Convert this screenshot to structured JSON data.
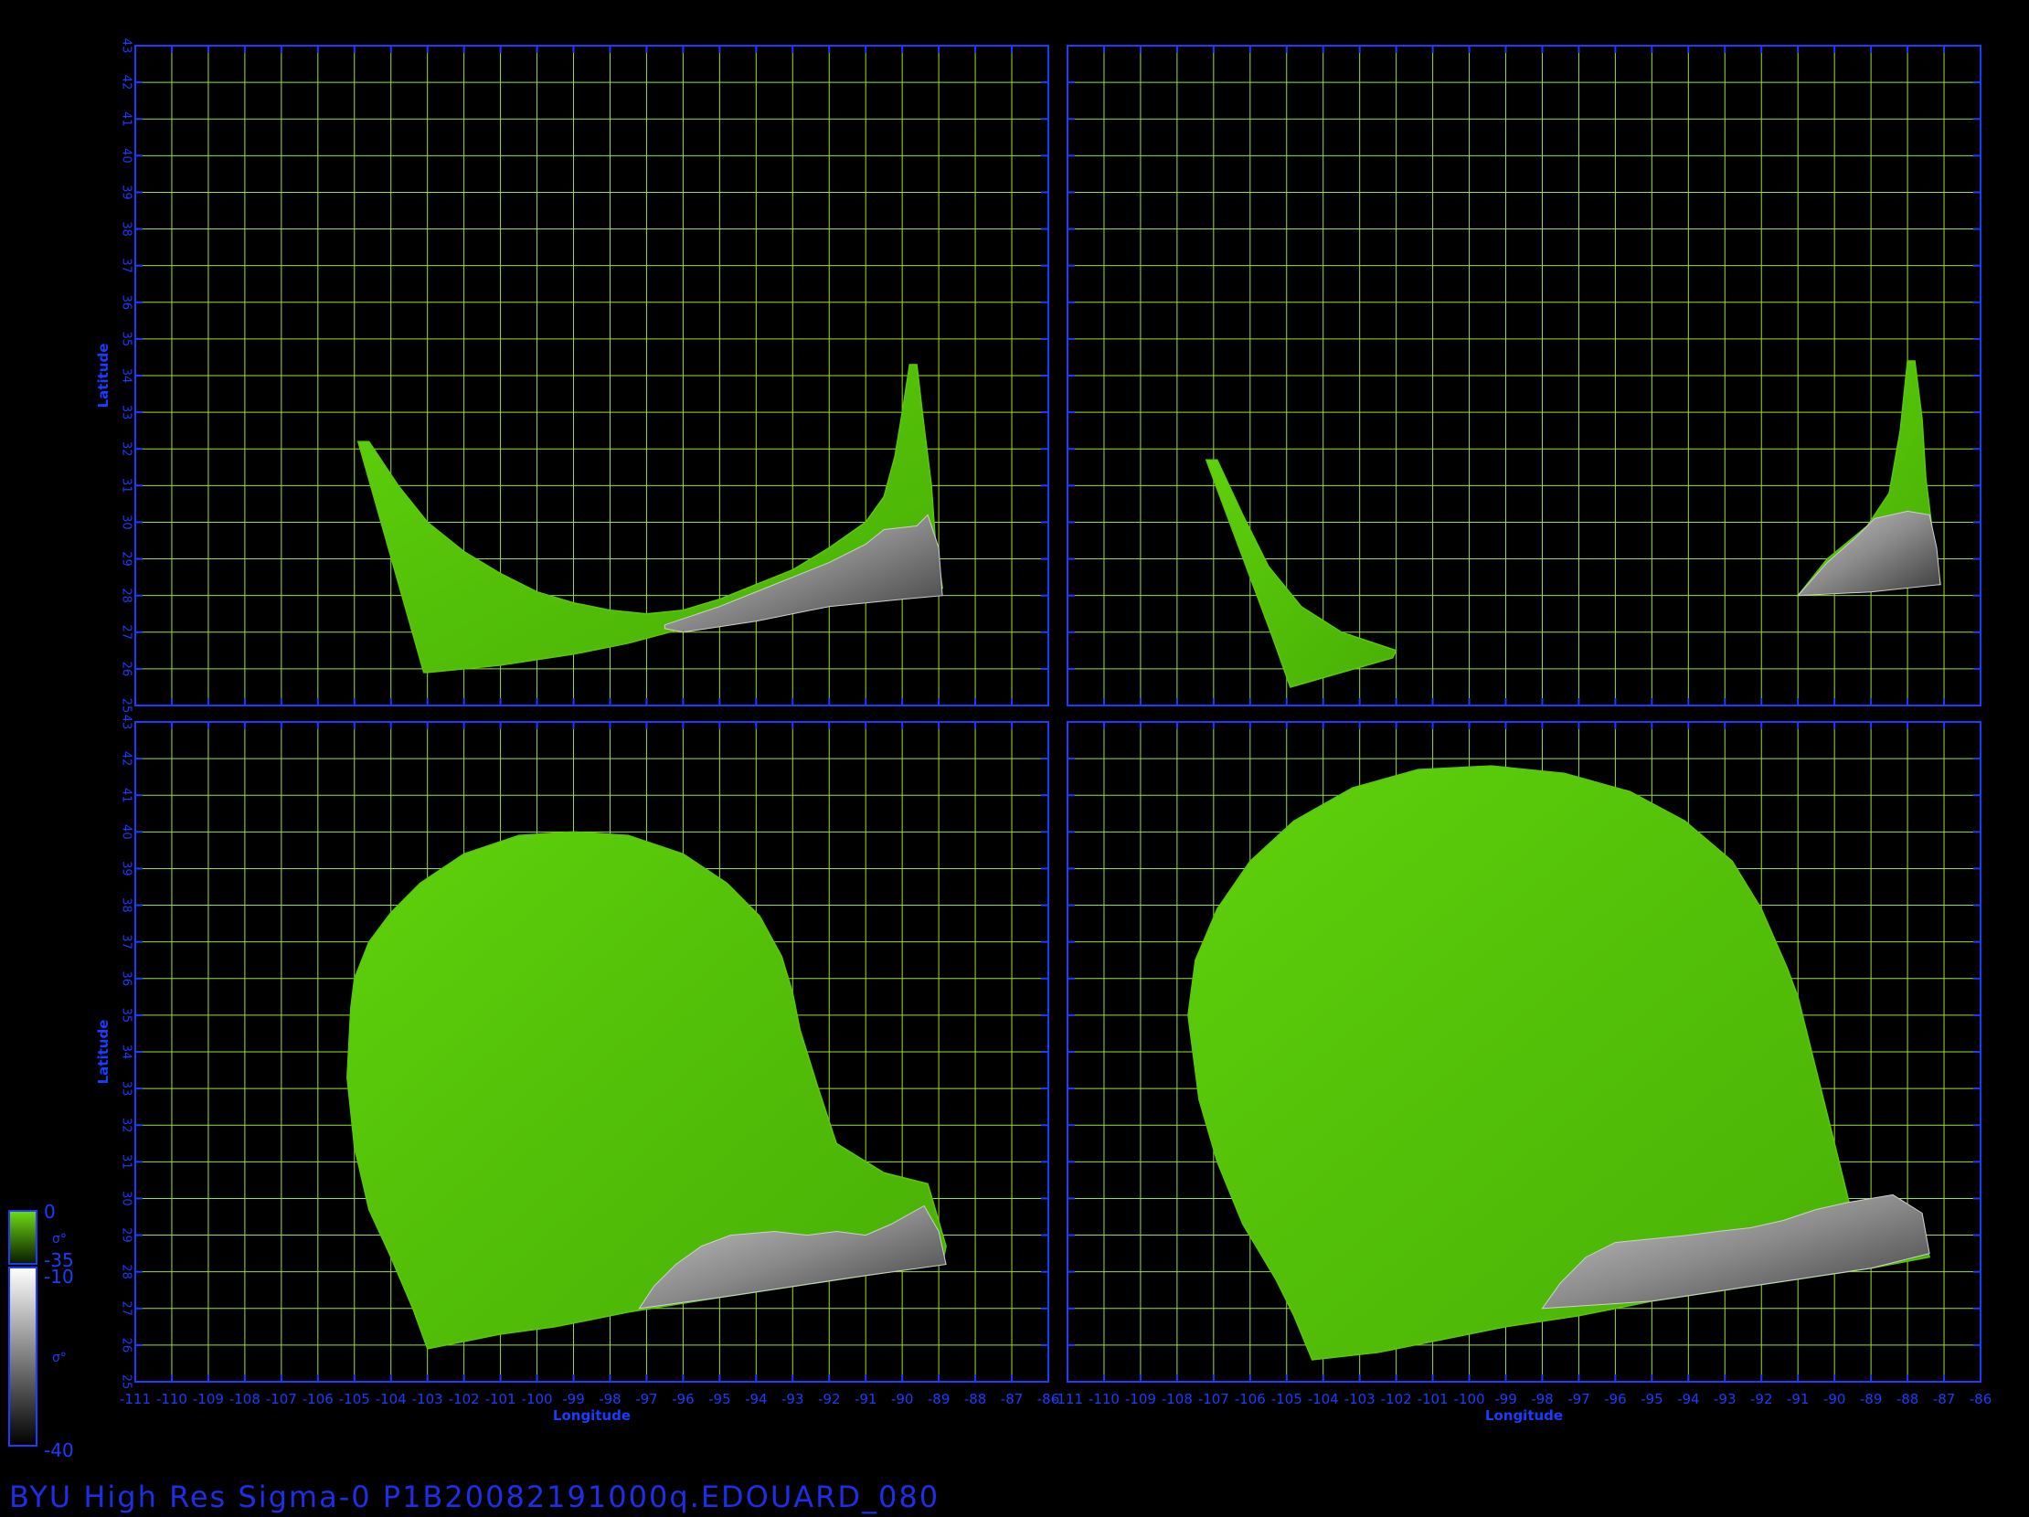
{
  "title": "BYU High Res Sigma-0 P1B20082191000q.EDOUARD_080",
  "axes": {
    "xlabel": "Longitude",
    "ylabel": "Latitude",
    "lon_range": [
      -111,
      -86
    ],
    "lat_range": [
      25,
      43
    ],
    "lon_ticks": [
      "-111",
      "-110",
      "-109",
      "-108",
      "-107",
      "-106",
      "-105",
      "-104",
      "-103",
      "-102",
      "-101",
      "-100",
      "-99",
      "-98",
      "-97",
      "-96",
      "-95",
      "-94",
      "-93",
      "-92",
      "-91",
      "-90",
      "-89",
      "-88",
      "-87",
      "-86"
    ],
    "lat_ticks": [
      "25",
      "26",
      "27",
      "28",
      "29",
      "30",
      "31",
      "32",
      "33",
      "34",
      "35",
      "36",
      "37",
      "38",
      "39",
      "40",
      "41",
      "42",
      "43"
    ]
  },
  "colorbar": {
    "ocean_top": "0",
    "ocean_bottom": "-35",
    "land_top": "-10",
    "land_bottom": "-40",
    "ocean_symbol": "σ°",
    "land_symbol": "σ°"
  },
  "colors": {
    "frame": "#1a3cff",
    "grid": "#9ce02a",
    "ocean": "#56c80a",
    "land": "#9a9a9a",
    "background": "#000000"
  },
  "panels": [
    {
      "id": "top-left",
      "ocean_swath": [
        [
          -104.9,
          32.2
        ],
        [
          -104.6,
          32.2
        ],
        [
          -103.8,
          31.0
        ],
        [
          -103.0,
          30.0
        ],
        [
          -102.0,
          29.2
        ],
        [
          -101.0,
          28.6
        ],
        [
          -100.0,
          28.1
        ],
        [
          -99.0,
          27.8
        ],
        [
          -98.0,
          27.6
        ],
        [
          -97.0,
          27.5
        ],
        [
          -96.0,
          27.6
        ],
        [
          -95.0,
          27.9
        ],
        [
          -94.0,
          28.3
        ],
        [
          -93.0,
          28.7
        ],
        [
          -92.0,
          29.3
        ],
        [
          -91.0,
          30.0
        ],
        [
          -90.5,
          30.7
        ],
        [
          -90.2,
          31.8
        ],
        [
          -90.0,
          33.0
        ],
        [
          -89.8,
          34.3
        ],
        [
          -89.6,
          34.3
        ],
        [
          -89.4,
          32.6
        ],
        [
          -89.2,
          31.0
        ],
        [
          -89.1,
          29.6
        ],
        [
          -88.9,
          28.2
        ],
        [
          -90.0,
          28.0
        ],
        [
          -92.0,
          27.8
        ],
        [
          -94.0,
          27.4
        ],
        [
          -96.0,
          27.1
        ],
        [
          -97.5,
          26.7
        ],
        [
          -99.0,
          26.4
        ],
        [
          -101.0,
          26.1
        ],
        [
          -103.0,
          25.9
        ],
        [
          -103.1,
          25.9
        ]
      ],
      "land_swath": [
        [
          -96.5,
          27.2
        ],
        [
          -95.0,
          27.7
        ],
        [
          -93.5,
          28.3
        ],
        [
          -92.0,
          28.9
        ],
        [
          -91.0,
          29.4
        ],
        [
          -90.5,
          29.8
        ],
        [
          -89.6,
          29.9
        ],
        [
          -89.3,
          30.2
        ],
        [
          -89.0,
          29.3
        ],
        [
          -88.9,
          28.0
        ],
        [
          -90.0,
          27.9
        ],
        [
          -92.0,
          27.7
        ],
        [
          -94.0,
          27.3
        ],
        [
          -96.0,
          27.0
        ],
        [
          -96.5,
          27.1
        ]
      ]
    },
    {
      "id": "top-right",
      "ocean_swath": [
        [
          -107.2,
          31.7
        ],
        [
          -106.9,
          31.7
        ],
        [
          -106.2,
          30.2
        ],
        [
          -105.5,
          28.8
        ],
        [
          -104.6,
          27.7
        ],
        [
          -103.5,
          27.0
        ],
        [
          -102.0,
          26.5
        ],
        [
          -102.1,
          26.3
        ],
        [
          -103.5,
          25.9
        ],
        [
          -104.9,
          25.5
        ],
        [
          -105.4,
          26.9
        ],
        [
          -106.3,
          29.3
        ],
        [
          -107.2,
          31.7
        ]
      ],
      "ocean_swath_b": [
        [
          -88.0,
          34.4
        ],
        [
          -87.8,
          34.4
        ],
        [
          -87.6,
          32.8
        ],
        [
          -87.5,
          31.2
        ],
        [
          -87.3,
          29.6
        ],
        [
          -87.1,
          28.3
        ],
        [
          -89.0,
          28.2
        ],
        [
          -91.0,
          28.0
        ],
        [
          -90.2,
          29.0
        ],
        [
          -89.1,
          29.9
        ],
        [
          -88.5,
          30.8
        ],
        [
          -88.2,
          32.5
        ],
        [
          -88.0,
          34.4
        ]
      ],
      "land_swath": [
        [
          -91.0,
          28.0
        ],
        [
          -90.2,
          28.9
        ],
        [
          -89.4,
          29.6
        ],
        [
          -88.9,
          30.1
        ],
        [
          -88.0,
          30.3
        ],
        [
          -87.4,
          30.2
        ],
        [
          -87.2,
          29.3
        ],
        [
          -87.1,
          28.3
        ],
        [
          -89.0,
          28.1
        ],
        [
          -91.0,
          28.0
        ]
      ]
    },
    {
      "id": "bottom-left",
      "ocean_swath": [
        [
          -105.1,
          35.2
        ],
        [
          -105.0,
          36.0
        ],
        [
          -104.6,
          37.0
        ],
        [
          -104.0,
          37.8
        ],
        [
          -103.2,
          38.6
        ],
        [
          -102.0,
          39.4
        ],
        [
          -100.5,
          39.9
        ],
        [
          -99.0,
          40.0
        ],
        [
          -97.5,
          39.9
        ],
        [
          -96.0,
          39.4
        ],
        [
          -94.8,
          38.6
        ],
        [
          -93.9,
          37.7
        ],
        [
          -93.3,
          36.6
        ],
        [
          -93.0,
          35.6
        ],
        [
          -92.8,
          34.6
        ],
        [
          -92.3,
          33.0
        ],
        [
          -91.8,
          31.5
        ],
        [
          -90.5,
          30.7
        ],
        [
          -89.3,
          30.4
        ],
        [
          -88.8,
          28.7
        ],
        [
          -88.9,
          28.2
        ],
        [
          -91.0,
          27.9
        ],
        [
          -93.0,
          27.6
        ],
        [
          -95.0,
          27.3
        ],
        [
          -97.5,
          26.9
        ],
        [
          -99.5,
          26.5
        ],
        [
          -101.0,
          26.3
        ],
        [
          -103.0,
          25.9
        ],
        [
          -103.4,
          27.0
        ],
        [
          -104.0,
          28.4
        ],
        [
          -104.6,
          29.7
        ],
        [
          -105.0,
          31.4
        ],
        [
          -105.2,
          33.3
        ],
        [
          -105.1,
          35.2
        ]
      ],
      "land_swath": [
        [
          -97.2,
          27.0
        ],
        [
          -96.8,
          27.6
        ],
        [
          -96.2,
          28.2
        ],
        [
          -95.5,
          28.7
        ],
        [
          -94.7,
          29.0
        ],
        [
          -93.5,
          29.1
        ],
        [
          -92.6,
          29.0
        ],
        [
          -91.8,
          29.1
        ],
        [
          -91.0,
          29.0
        ],
        [
          -90.3,
          29.3
        ],
        [
          -89.4,
          29.8
        ],
        [
          -89.0,
          29.1
        ],
        [
          -88.8,
          28.2
        ],
        [
          -91.0,
          27.9
        ],
        [
          -93.0,
          27.6
        ],
        [
          -95.0,
          27.3
        ],
        [
          -97.2,
          27.0
        ]
      ]
    },
    {
      "id": "bottom-right",
      "ocean_swath": [
        [
          -107.7,
          35.0
        ],
        [
          -107.5,
          36.5
        ],
        [
          -106.9,
          37.9
        ],
        [
          -106.0,
          39.2
        ],
        [
          -104.8,
          40.3
        ],
        [
          -103.2,
          41.2
        ],
        [
          -101.4,
          41.7
        ],
        [
          -99.4,
          41.8
        ],
        [
          -97.4,
          41.6
        ],
        [
          -95.6,
          41.1
        ],
        [
          -94.1,
          40.3
        ],
        [
          -92.8,
          39.2
        ],
        [
          -92.0,
          37.9
        ],
        [
          -91.3,
          36.3
        ],
        [
          -91.0,
          35.5
        ],
        [
          -90.5,
          33.5
        ],
        [
          -90.0,
          31.5
        ],
        [
          -89.6,
          29.9
        ],
        [
          -87.7,
          29.5
        ],
        [
          -87.4,
          28.4
        ],
        [
          -89.0,
          28.1
        ],
        [
          -91.0,
          27.8
        ],
        [
          -93.0,
          27.5
        ],
        [
          -95.0,
          27.2
        ],
        [
          -97.0,
          26.8
        ],
        [
          -99.0,
          26.5
        ],
        [
          -101.0,
          26.1
        ],
        [
          -102.5,
          25.8
        ],
        [
          -104.3,
          25.6
        ],
        [
          -104.8,
          26.8
        ],
        [
          -105.3,
          27.8
        ],
        [
          -106.2,
          29.3
        ],
        [
          -106.9,
          31.0
        ],
        [
          -107.4,
          32.7
        ],
        [
          -107.7,
          35.0
        ]
      ],
      "land_swath": [
        [
          -98.0,
          27.0
        ],
        [
          -97.5,
          27.7
        ],
        [
          -96.8,
          28.4
        ],
        [
          -96.0,
          28.8
        ],
        [
          -95.0,
          28.9
        ],
        [
          -94.0,
          29.0
        ],
        [
          -93.2,
          29.1
        ],
        [
          -92.3,
          29.2
        ],
        [
          -91.4,
          29.4
        ],
        [
          -90.5,
          29.7
        ],
        [
          -89.6,
          29.9
        ],
        [
          -88.4,
          30.1
        ],
        [
          -87.6,
          29.6
        ],
        [
          -87.4,
          28.5
        ],
        [
          -89.0,
          28.1
        ],
        [
          -91.0,
          27.8
        ],
        [
          -93.0,
          27.5
        ],
        [
          -95.0,
          27.2
        ],
        [
          -98.0,
          27.0
        ]
      ]
    }
  ]
}
